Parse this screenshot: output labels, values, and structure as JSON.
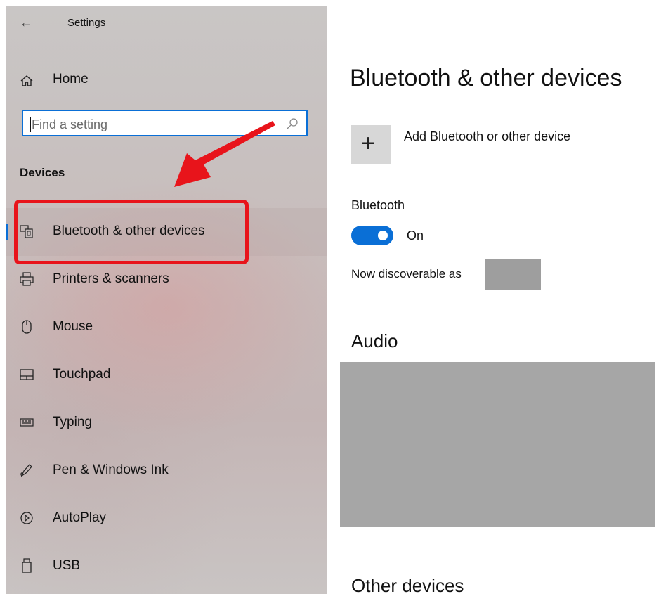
{
  "window": {
    "title": "Settings",
    "back_icon": "back-arrow-icon"
  },
  "sidebar": {
    "home_label": "Home",
    "search": {
      "placeholder": "Find a setting",
      "value": ""
    },
    "section_heading": "Devices",
    "items": [
      {
        "label": "Bluetooth & other devices",
        "icon": "bluetooth-devices-icon",
        "selected": true
      },
      {
        "label": "Printers & scanners",
        "icon": "printer-icon",
        "selected": false
      },
      {
        "label": "Mouse",
        "icon": "mouse-icon",
        "selected": false
      },
      {
        "label": "Touchpad",
        "icon": "touchpad-icon",
        "selected": false
      },
      {
        "label": "Typing",
        "icon": "keyboard-icon",
        "selected": false
      },
      {
        "label": "Pen & Windows Ink",
        "icon": "pen-icon",
        "selected": false
      },
      {
        "label": "AutoPlay",
        "icon": "autoplay-icon",
        "selected": false
      },
      {
        "label": "USB",
        "icon": "usb-icon",
        "selected": false
      }
    ]
  },
  "main": {
    "title": "Bluetooth & other devices",
    "add_device": {
      "symbol": "+",
      "label": "Add Bluetooth or other device"
    },
    "bluetooth": {
      "label": "Bluetooth",
      "state_label": "On",
      "enabled": true
    },
    "discoverable_label": "Now discoverable as",
    "audio_heading": "Audio",
    "other_heading": "Other devices"
  },
  "colors": {
    "accent": "#0a6fd6",
    "annotation": "#e8141b",
    "redaction": "#a6a6a6"
  }
}
